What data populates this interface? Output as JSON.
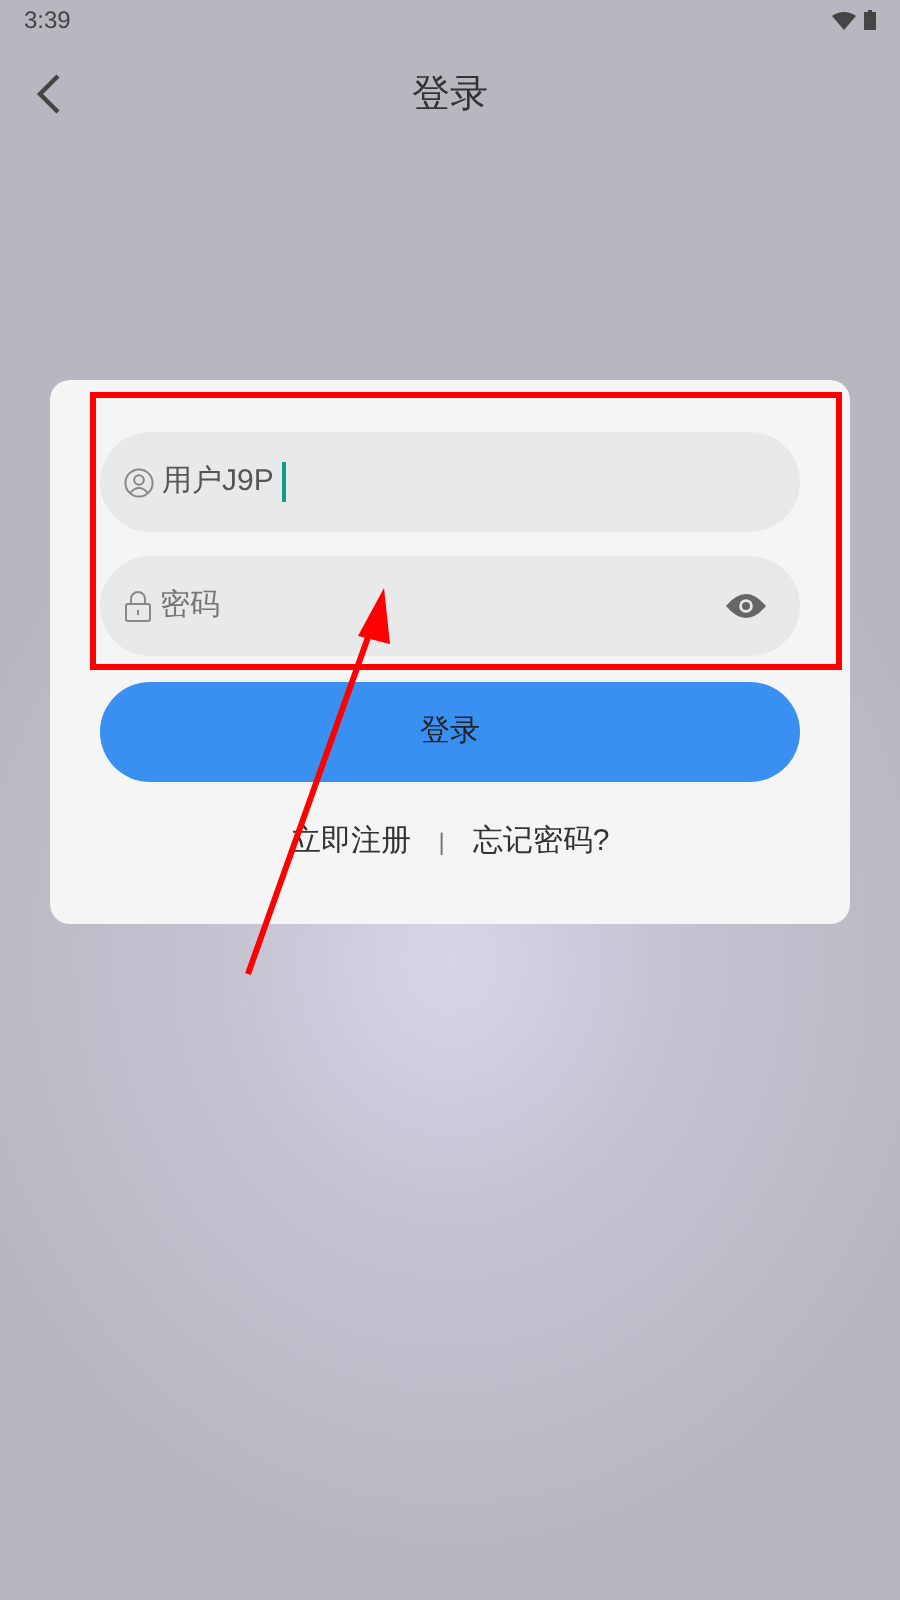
{
  "status_bar": {
    "time": "3:39"
  },
  "header": {
    "title": "登录"
  },
  "login_form": {
    "username": {
      "value": "用户J9P",
      "focused": true
    },
    "password": {
      "placeholder": "密码"
    },
    "submit": "登录",
    "links": [
      {
        "label": "立即注册"
      },
      {
        "label": "忘记密码?"
      }
    ],
    "separator": "|"
  },
  "annotations": {
    "highlight_box": true,
    "arrow": true
  }
}
